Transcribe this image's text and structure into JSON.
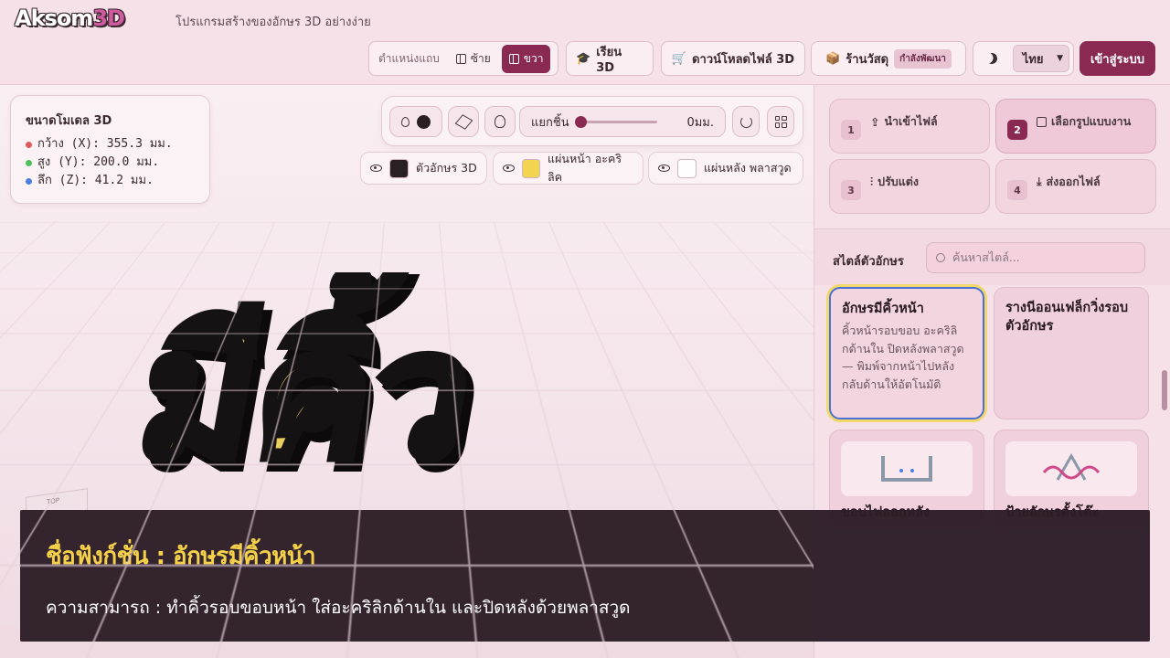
{
  "header": {
    "logo_main": "Aksom",
    "logo_accent": "3D",
    "tagline": "โปรแกรมสร้างของอักษร 3D อย่างง่าย",
    "position_label": "ตำแหน่งแถบ",
    "position_left": "ซ้าย",
    "position_right": "ขวา",
    "learn_3d": "เรียน 3D",
    "download_files": "ดาวน์โหลดไฟล์ 3D",
    "store": "ร้านวัสดุ",
    "store_badge": "กำลังพัฒนา",
    "language": "ไทย",
    "login": "เข้าสู่ระบบ"
  },
  "dimensions": {
    "title_prefix": "ขนาดโมเดล",
    "title_suffix": "3D",
    "x": "กว้าง (X): 355.3 มม.",
    "y": "สูง (Y): 200.0 มม.",
    "z": "ลึก (Z): 41.2 มม.",
    "x_color": "#e05a5a",
    "y_color": "#4fbf5a",
    "z_color": "#4a7fe0"
  },
  "toolbar": {
    "separate_label": "แยกชิ้น",
    "separate_value": "0มม.",
    "separate_fraction": 0
  },
  "layers": [
    {
      "label": "ตัวอักษร 3D",
      "color": "#2a2024"
    },
    {
      "label": "แผ่นหน้า อะคริลิค",
      "color": "#f2d450"
    },
    {
      "label": "แผ่นหลัง พลาสวูด",
      "color": "#ffffff"
    }
  ],
  "model": {
    "text": "มีคิ้ว",
    "face_color": "#e8cf5e",
    "side_color": "#151214",
    "top_cube_label": "TOP"
  },
  "steps": [
    {
      "num": "1",
      "label": "นำเข้าไฟล์"
    },
    {
      "num": "2",
      "label": "เลือกรูปแบบงาน"
    },
    {
      "num": "3",
      "label": "ปรับแต่ง"
    },
    {
      "num": "4",
      "label": "ส่งออกไฟล์"
    }
  ],
  "styles": {
    "title": "สไตล์ตัวอักษร",
    "search_placeholder": "ค้นหาสไตล์...",
    "cards": [
      {
        "title": "อักษรมีคิ้วหน้า",
        "desc": "คิ้วหน้ารอบขอบ อะคริลิกด้านใน ปิดหลังพลาสวูด — พิมพ์จากหน้าไปหลัง กลับด้านให้อัตโนมัติ"
      },
      {
        "title": "รางนีออนเฟล็กวิ่งรอบตัวอักษร",
        "desc": ""
      },
      {
        "title": "ขอบไฟออกหลัง",
        "desc": ""
      },
      {
        "title": "ป้ายอักษรตั้งโต๊ะ",
        "desc": ""
      }
    ]
  },
  "caption": {
    "title": "ชื่อฟังก์ชั่น : อักษรมีคิ้วหน้า",
    "desc": "ความสามารถ : ทำคิ้วรอบขอบหน้า ใส่อะคริลิกด้านใน และปิดหลังด้วยพลาสวูด"
  }
}
